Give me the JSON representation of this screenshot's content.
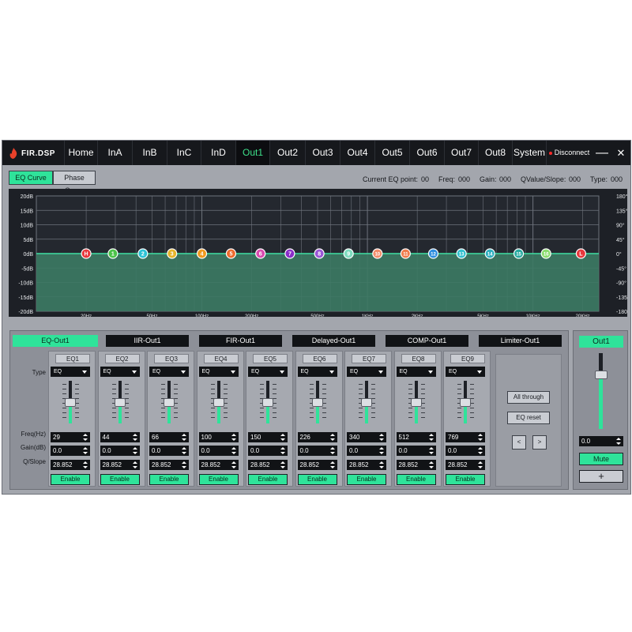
{
  "app": {
    "logo_text": "FIR.DSP",
    "tabs": [
      "Home",
      "InA",
      "InB",
      "InC",
      "InD",
      "Out1",
      "Out2",
      "Out3",
      "Out4",
      "Out5",
      "Out6",
      "Out7",
      "Out8",
      "System"
    ],
    "active_tab": "Out1",
    "disconnect_label": "Disconnect",
    "minimize_glyph": "—",
    "close_glyph": "✕"
  },
  "curve_buttons": {
    "eq": "EQ Curve",
    "phase": "Phase Curve"
  },
  "info": {
    "current_label": "Current EQ point:",
    "current_value": "00",
    "freq_label": "Freq:",
    "freq_value": "000",
    "gain_label": "Gain:",
    "gain_value": "000",
    "q_label": "QValue/Slope:",
    "q_value": "000",
    "type_label": "Type:",
    "type_value": "000"
  },
  "chart_data": {
    "type": "line",
    "left_axis_labels": [
      "20dB",
      "15dB",
      "10dB",
      "5dB",
      "0dB",
      "-5dB",
      "-10dB",
      "-15dB",
      "-20dB"
    ],
    "right_axis_labels": [
      "180°",
      "135°",
      "90°",
      "45°",
      "0°",
      "-45°",
      "-90°",
      "-135°",
      "-180°"
    ],
    "x_labels": [
      "20Hz",
      "50Hz",
      "100Hz",
      "200Hz",
      "500Hz",
      "1KHz",
      "2KHz",
      "5KHz",
      "10KHz",
      "20KHz"
    ],
    "x_label_freqs": [
      20,
      50,
      100,
      200,
      500,
      1000,
      2000,
      5000,
      10000,
      20000
    ],
    "xlim": [
      10,
      25000
    ],
    "ylim": [
      -20,
      20
    ],
    "gain_db": 0,
    "points": [
      {
        "label": "H",
        "freq": 20,
        "color": "#e8383d"
      },
      {
        "label": "1",
        "freq": 29,
        "color": "#4cc34a"
      },
      {
        "label": "2",
        "freq": 44,
        "color": "#2dc3d6"
      },
      {
        "label": "3",
        "freq": 66,
        "color": "#e7b52b"
      },
      {
        "label": "4",
        "freq": 100,
        "color": "#f09a1e"
      },
      {
        "label": "5",
        "freq": 150,
        "color": "#ef6b2d"
      },
      {
        "label": "6",
        "freq": 226,
        "color": "#d94bb0"
      },
      {
        "label": "7",
        "freq": 340,
        "color": "#8a2ec9"
      },
      {
        "label": "8",
        "freq": 512,
        "color": "#9a55d6"
      },
      {
        "label": "9",
        "freq": 769,
        "color": "#7fdcc0"
      },
      {
        "label": "10",
        "freq": 1150,
        "color": "#f28c6a"
      },
      {
        "label": "11",
        "freq": 1700,
        "color": "#f07b4b"
      },
      {
        "label": "12",
        "freq": 2500,
        "color": "#2f8ee0"
      },
      {
        "label": "13",
        "freq": 3700,
        "color": "#34c1cf"
      },
      {
        "label": "14",
        "freq": 5500,
        "color": "#30b0c0"
      },
      {
        "label": "15",
        "freq": 8200,
        "color": "#27a9a0"
      },
      {
        "label": "16",
        "freq": 12000,
        "color": "#8bdc6f"
      },
      {
        "label": "L",
        "freq": 19500,
        "color": "#e8383d"
      }
    ],
    "colors": {
      "fill": "#3c7a64",
      "line": "#3fe0a4",
      "grid": "#6e737c",
      "bg": "#1d2026"
    }
  },
  "modules": [
    "EQ-Out1",
    "IIR-Out1",
    "FIR-Out1",
    "Delayed-Out1",
    "COMP-Out1",
    "Limiter-Out1"
  ],
  "row_labels": {
    "type": "Type",
    "freq": "Freq(Hz)",
    "gain": "Gain(dB)",
    "q": "Q/Slope"
  },
  "eq_bands": [
    {
      "name": "EQ1",
      "type": "EQ",
      "freq": "29",
      "gain": "0.0",
      "q": "28.852",
      "enable": "Enable"
    },
    {
      "name": "EQ2",
      "type": "EQ",
      "freq": "44",
      "gain": "0.0",
      "q": "28.852",
      "enable": "Enable"
    },
    {
      "name": "EQ3",
      "type": "EQ",
      "freq": "66",
      "gain": "0.0",
      "q": "28.852",
      "enable": "Enable"
    },
    {
      "name": "EQ4",
      "type": "EQ",
      "freq": "100",
      "gain": "0.0",
      "q": "28.852",
      "enable": "Enable"
    },
    {
      "name": "EQ5",
      "type": "EQ",
      "freq": "150",
      "gain": "0.0",
      "q": "28.852",
      "enable": "Enable"
    },
    {
      "name": "EQ6",
      "type": "EQ",
      "freq": "226",
      "gain": "0.0",
      "q": "28.852",
      "enable": "Enable"
    },
    {
      "name": "EQ7",
      "type": "EQ",
      "freq": "340",
      "gain": "0.0",
      "q": "28.852",
      "enable": "Enable"
    },
    {
      "name": "EQ8",
      "type": "EQ",
      "freq": "512",
      "gain": "0.0",
      "q": "28.852",
      "enable": "Enable"
    },
    {
      "name": "EQ9",
      "type": "EQ",
      "freq": "769",
      "gain": "0.0",
      "q": "28.852",
      "enable": "Enable"
    }
  ],
  "eq_slider_level": 0.5,
  "actions": {
    "all_through": "All through",
    "eq_reset": "EQ reset",
    "prev": "<",
    "next": ">"
  },
  "output": {
    "title": "Out1",
    "gain": "0.0",
    "mute": "Mute",
    "add": "+",
    "level": 0.72
  }
}
